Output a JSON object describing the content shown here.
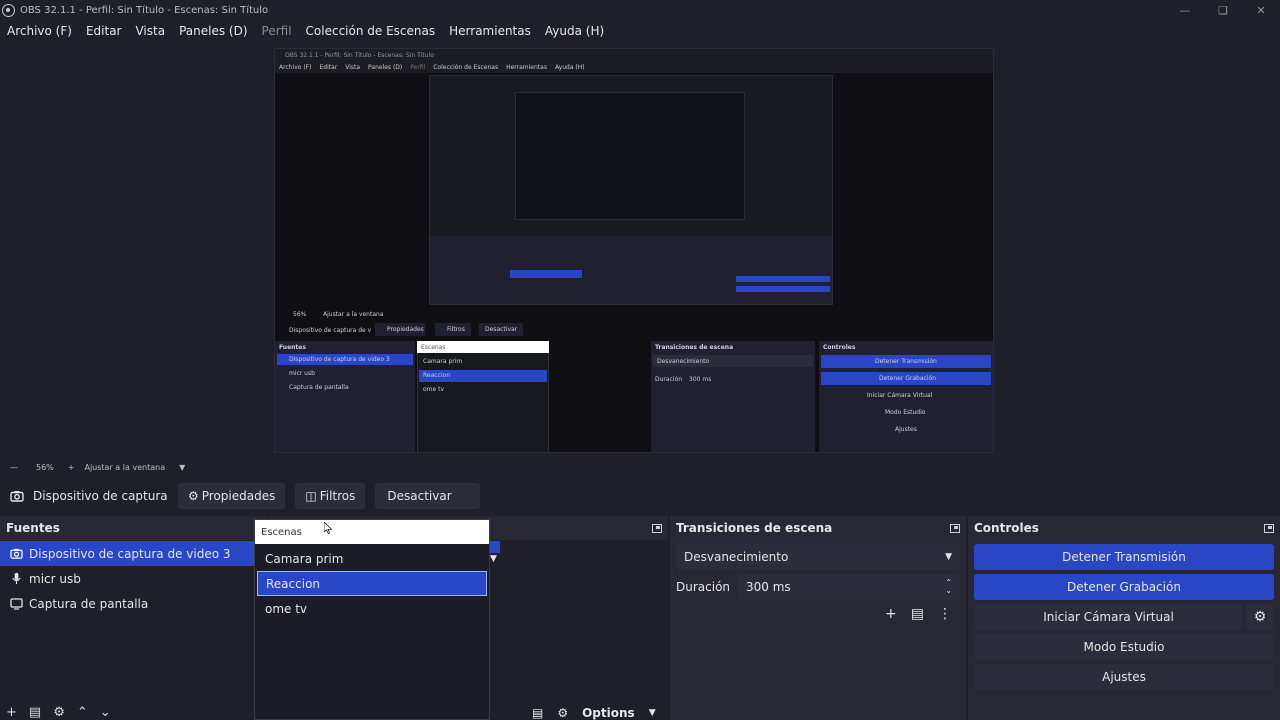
{
  "window": {
    "title": "OBS 32.1.1 - Perfil: Sin Título - Escenas: Sin Título"
  },
  "menubar": {
    "items": [
      "Archivo (F)",
      "Editar",
      "Vista",
      "Paneles (D)",
      "Perfil",
      "Colección de Escenas",
      "Herramientas",
      "Ayuda (H)"
    ]
  },
  "nested_preview": {
    "title": "OBS 32.1.1 - Perfil: Sin Título - Escenas: Sin Título",
    "menu": [
      "Archivo (F)",
      "Editar",
      "Vista",
      "Paneles (D)",
      "Perfil",
      "Colección de Escenas",
      "Herramientas",
      "Ayuda (H)"
    ],
    "toolbar_source": "Dispositivo de captura de v",
    "toolbar_buttons": [
      "Propiedades",
      "Filtros",
      "Desactivar"
    ],
    "fuentes": "Fuentes",
    "sources": [
      "Dispositivo de captura de video 3",
      "micr usb",
      "Captura de pantalla"
    ],
    "escenas": "Escenas",
    "scenes": [
      "Camara prim",
      "Reaccion",
      "ome tv"
    ],
    "transiciones": "Transiciones de escena",
    "transition": "Desvanecimiento",
    "duracion": "Duración",
    "duration": "300 ms",
    "controles": "Controles",
    "controls": [
      "Detener Transmisión",
      "Detener Grabación",
      "Iniciar Cámara Virtual",
      "Modo Estudio",
      "Ajustes"
    ],
    "zoom": "56%",
    "fit": "Ajustar a la ventana"
  },
  "zoombar": {
    "zoom": "56%",
    "fit_label": "Ajustar a la ventana"
  },
  "toolbar": {
    "source_name": "Dispositivo de captura de v",
    "properties": "Propiedades",
    "filters": "Filtros",
    "deactivate": "Desactivar"
  },
  "sources": {
    "title": "Fuentes",
    "items": [
      {
        "name": "Dispositivo de captura de video 3",
        "icon": "camera-icon",
        "selected": true
      },
      {
        "name": "micr usb",
        "icon": "microphone-icon",
        "selected": false
      },
      {
        "name": "Captura de pantalla",
        "icon": "monitor-icon",
        "selected": false
      }
    ]
  },
  "scenes": {
    "search_placeholder": "Escenas",
    "items": [
      {
        "name": "Camara prim",
        "selected": false
      },
      {
        "name": "Reaccion",
        "selected": true
      },
      {
        "name": "ome tv",
        "selected": false
      }
    ],
    "options_label": "Options"
  },
  "transitions": {
    "title": "Transiciones de escena",
    "selected": "Desvanecimiento",
    "duration_label": "Duración",
    "duration_value": "300 ms"
  },
  "controls": {
    "title": "Controles",
    "stop_stream": "Detener Transmisión",
    "stop_record": "Detener Grabación",
    "virtual_cam": "Iniciar Cámara Virtual",
    "studio_mode": "Modo Estudio",
    "settings": "Ajustes"
  },
  "colors": {
    "accent": "#2946c7",
    "background": "#1e1f29",
    "dock": "#272833",
    "button": "#2c2d3a"
  }
}
